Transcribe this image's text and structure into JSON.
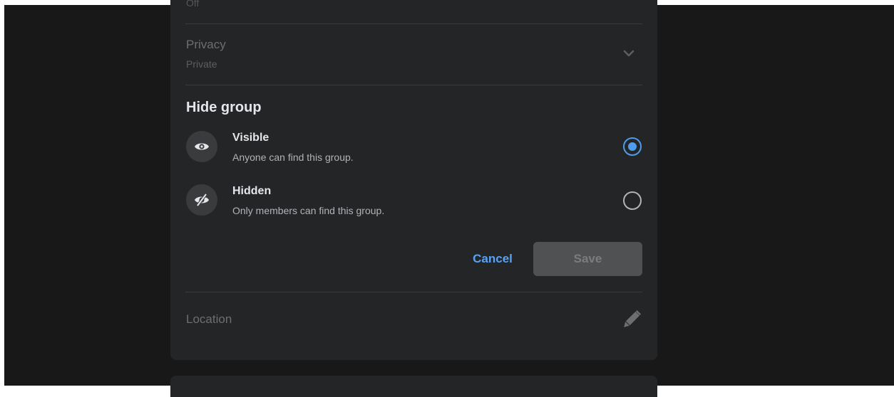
{
  "top_faded_text": "Off",
  "privacy": {
    "label": "Privacy",
    "value": "Private",
    "icon": "chevron-down-icon"
  },
  "hide_group": {
    "title": "Hide group",
    "options": [
      {
        "label": "Visible",
        "description": "Anyone can find this group.",
        "icon": "eye-icon",
        "selected": true
      },
      {
        "label": "Hidden",
        "description": "Only members can find this group.",
        "icon": "eye-slash-icon",
        "selected": false
      }
    ]
  },
  "actions": {
    "cancel_label": "Cancel",
    "save_label": "Save"
  },
  "location": {
    "label": "Location",
    "icon": "pencil-icon"
  },
  "colors": {
    "accent": "#4e9bf0",
    "card_background": "#242526",
    "page_background": "#181818"
  }
}
